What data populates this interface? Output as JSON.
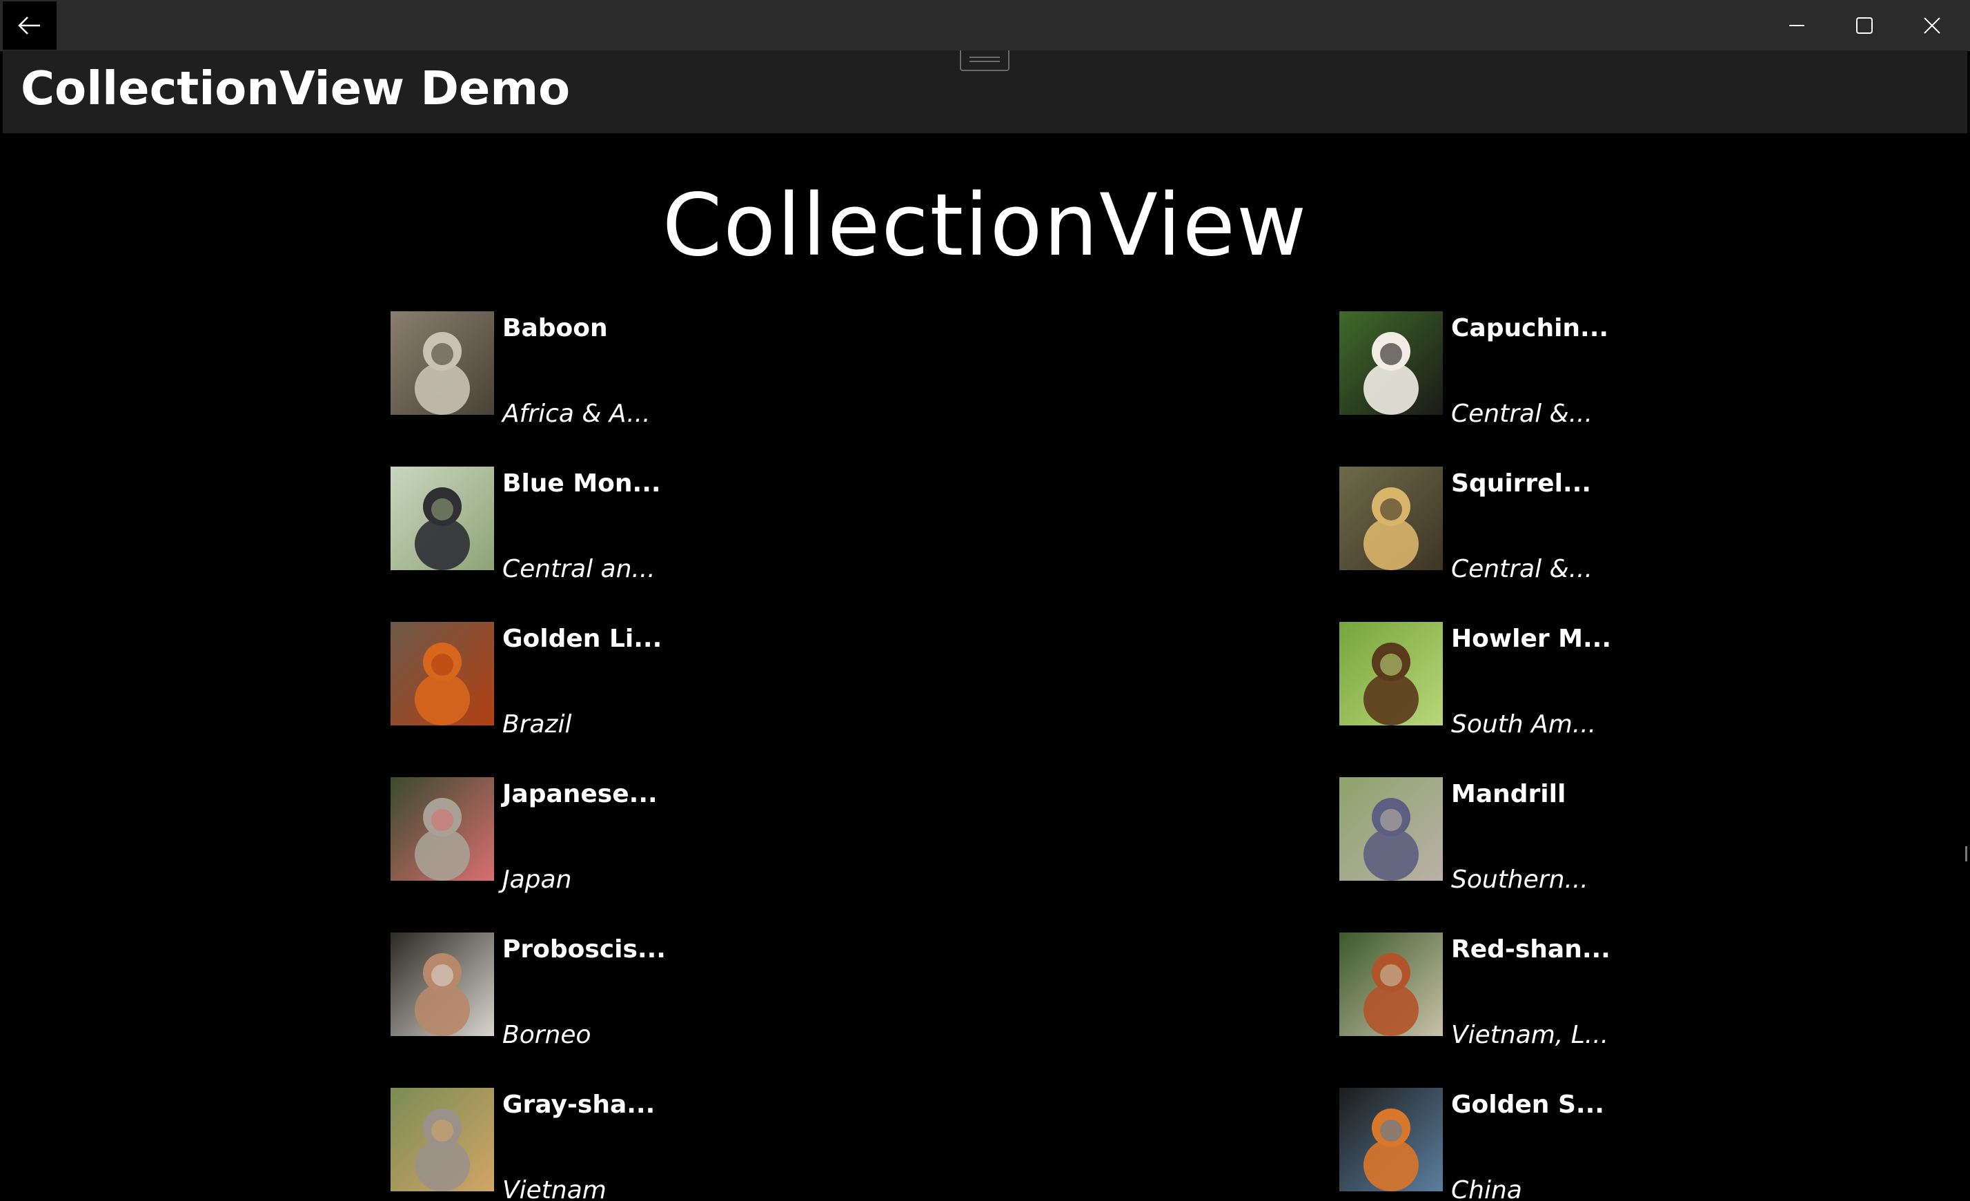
{
  "window": {
    "back_icon": "arrow-left-icon",
    "minimize_icon": "minimize-icon",
    "maximize_icon": "maximize-icon",
    "close_icon": "close-icon"
  },
  "header": {
    "title": "CollectionView Demo"
  },
  "main": {
    "heading": "CollectionView",
    "items": [
      {
        "name": "Baboon",
        "location": "Africa & A...",
        "colors": [
          "#8a7f6e",
          "#c9c2b3",
          "#4a4236"
        ]
      },
      {
        "name": "Capuchin...",
        "location": "Central &...",
        "colors": [
          "#3f6b2a",
          "#f1ede4",
          "#1b1a17"
        ]
      },
      {
        "name": "Blue Mon...",
        "location": "Central an...",
        "colors": [
          "#c9d6bf",
          "#2f2f34",
          "#8ea477"
        ]
      },
      {
        "name": "Squirrel...",
        "location": "Central &...",
        "colors": [
          "#6d6a4a",
          "#d9b56a",
          "#3e3524"
        ]
      },
      {
        "name": "Golden Li...",
        "location": "Brazil",
        "colors": [
          "#6d5a4a",
          "#d8661c",
          "#b14012"
        ]
      },
      {
        "name": "Howler M...",
        "location": "South Am...",
        "colors": [
          "#76a63c",
          "#5a3a1c",
          "#b9d67a"
        ]
      },
      {
        "name": "Japanese...",
        "location": "Japan",
        "colors": [
          "#3a4a2e",
          "#a9a196",
          "#d86f6f"
        ]
      },
      {
        "name": "Mandrill",
        "location": "Southern...",
        "colors": [
          "#8ea36b",
          "#5d5f80",
          "#b9b1a8"
        ]
      },
      {
        "name": "Proboscis...",
        "location": "Borneo",
        "colors": [
          "#2c2a22",
          "#b7886a",
          "#d8d4ce"
        ]
      },
      {
        "name": "Red-shan...",
        "location": "Vietnam, L...",
        "colors": [
          "#3c5a2a",
          "#b2542a",
          "#c8c1a8"
        ]
      },
      {
        "name": "Gray-sha...",
        "location": "Vietnam",
        "colors": [
          "#7a8c55",
          "#9a918a",
          "#d2a566"
        ]
      },
      {
        "name": "Golden S...",
        "location": "China",
        "colors": [
          "#1d1c1b",
          "#d9772a",
          "#5b7fa0"
        ]
      }
    ]
  }
}
